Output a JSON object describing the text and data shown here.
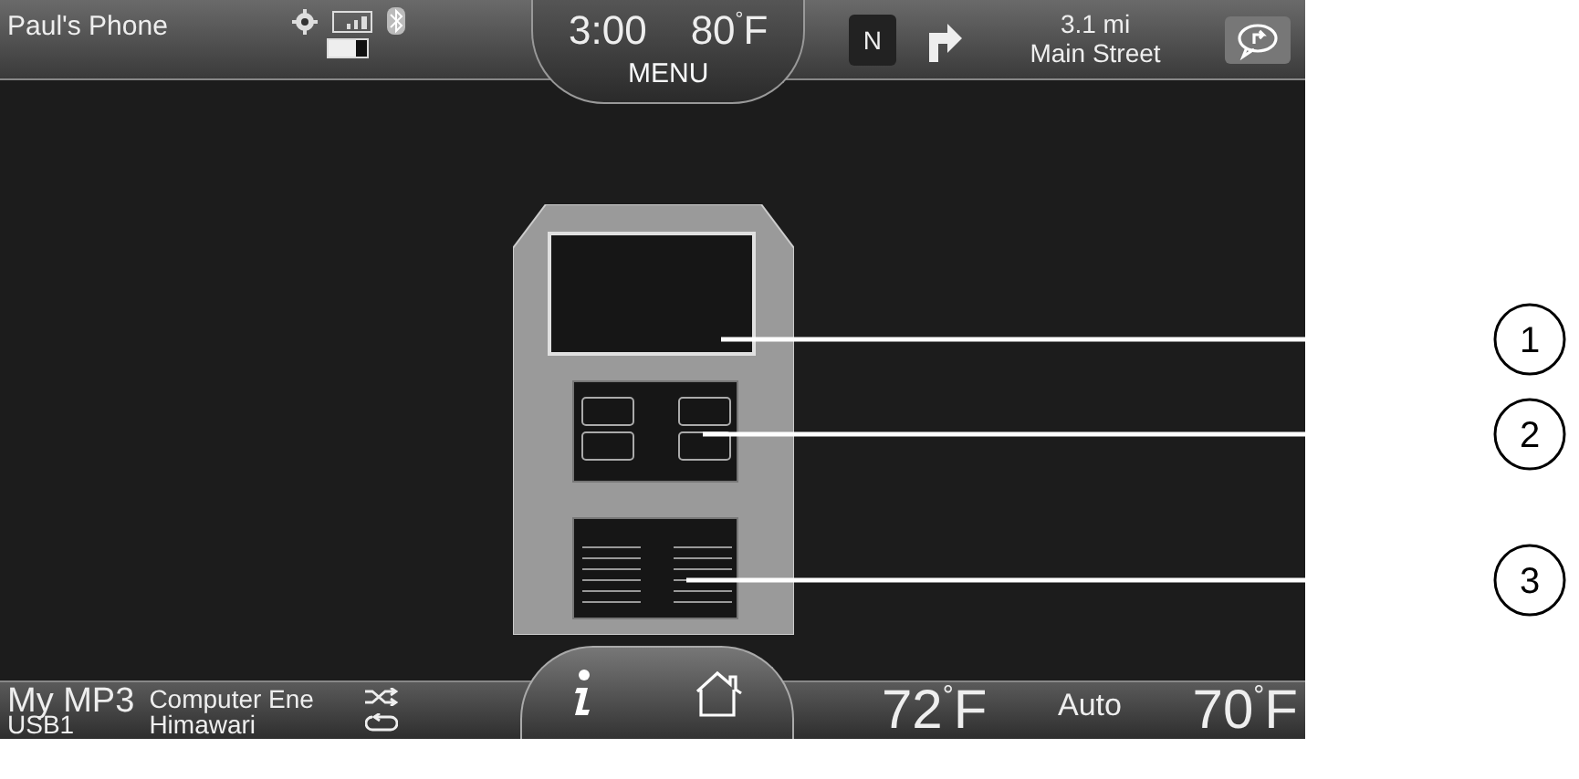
{
  "status_bar": {
    "phone_name": "Paul's Phone",
    "time": "3:00",
    "temperature": "80$^{°}$F",
    "menu": "MENU"
  },
  "navigation": {
    "compass": "N",
    "distance": "3.1 mi",
    "street": "Main Street"
  },
  "media": {
    "source": "My MP3",
    "device": "USB1",
    "artist": "Computer Ene",
    "track": "Himawari"
  },
  "climate": {
    "driver_temp": "72$^{°}$F",
    "mode": "Auto",
    "passenger_temp": "70$^{°}$F"
  },
  "callouts": [
    "1",
    "2",
    "3"
  ]
}
